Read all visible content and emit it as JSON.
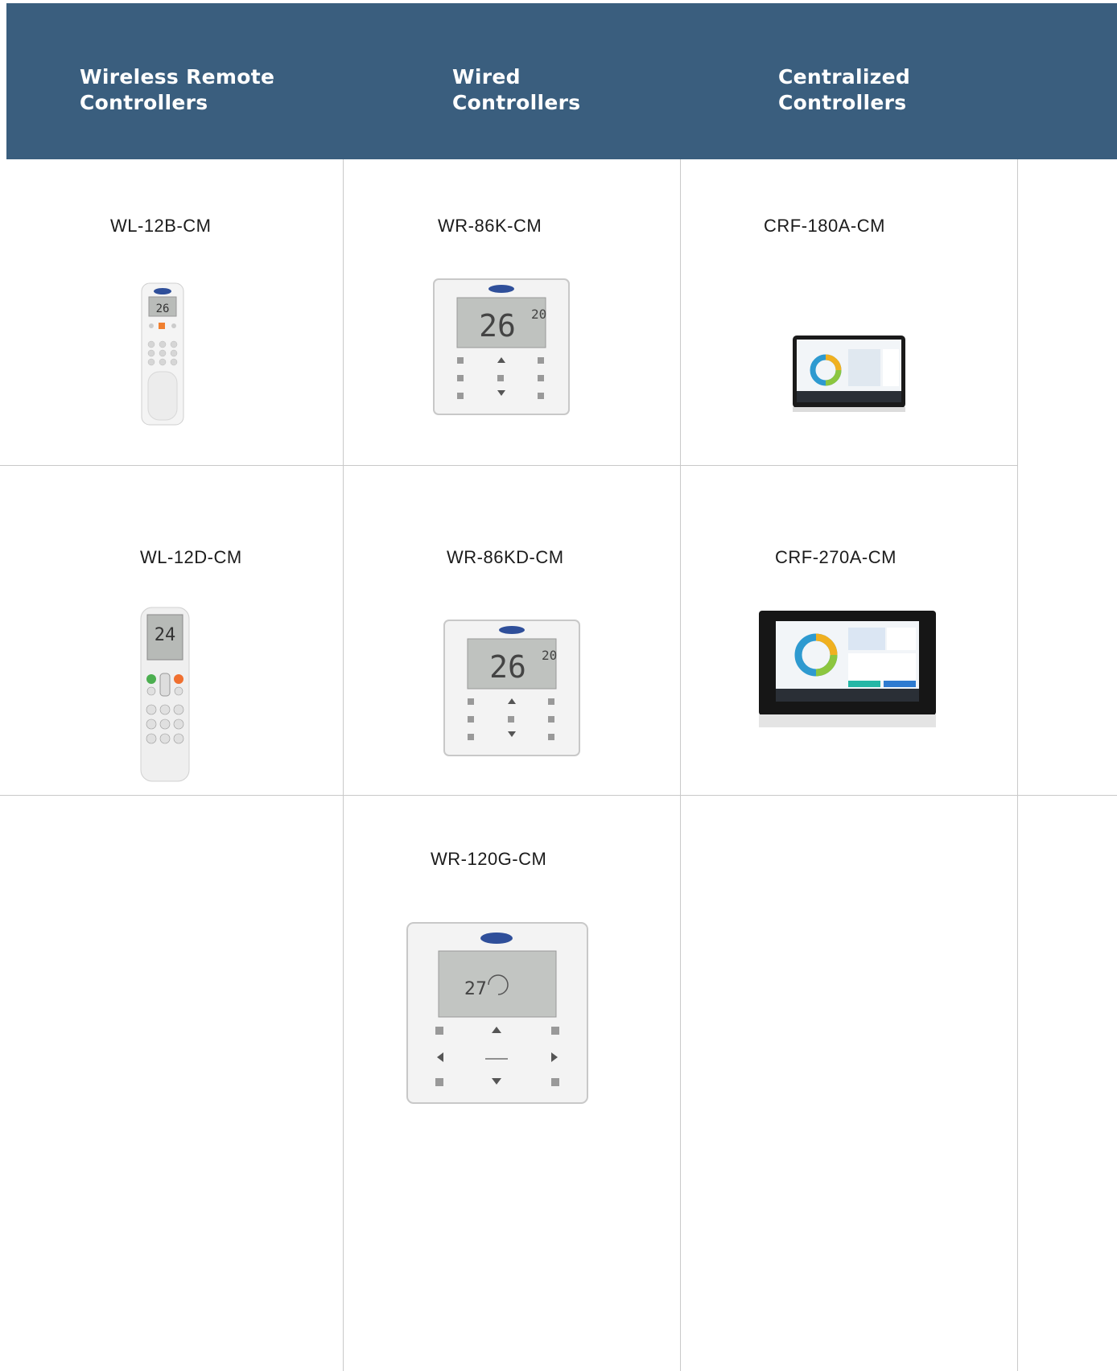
{
  "headers": {
    "wireless": "Wireless Remote\nControllers",
    "wired": "Wired\nControllers",
    "centralized": "Centralized\nControllers"
  },
  "models": {
    "wl12b": "WL-12B-CM",
    "wr86k": "WR-86K-CM",
    "crf180a": "CRF-180A-CM",
    "wl12d": "WL-12D-CM",
    "wr86kd": "WR-86KD-CM",
    "crf270a": "CRF-270A-CM",
    "wr120g": "WR-120G-CM"
  },
  "images": {
    "wl12b": "remote-controller-image",
    "wr86k": "wired-controller-image",
    "crf180a": "touchscreen-controller-image",
    "wl12d": "remote-controller-image",
    "wr86kd": "wired-controller-image",
    "crf270a": "touchscreen-controller-image",
    "wr120g": "wired-controller-image"
  },
  "colors": {
    "header_bg": "#3a5e7e",
    "header_text": "#ffffff",
    "grid": "#c9c9c9"
  }
}
